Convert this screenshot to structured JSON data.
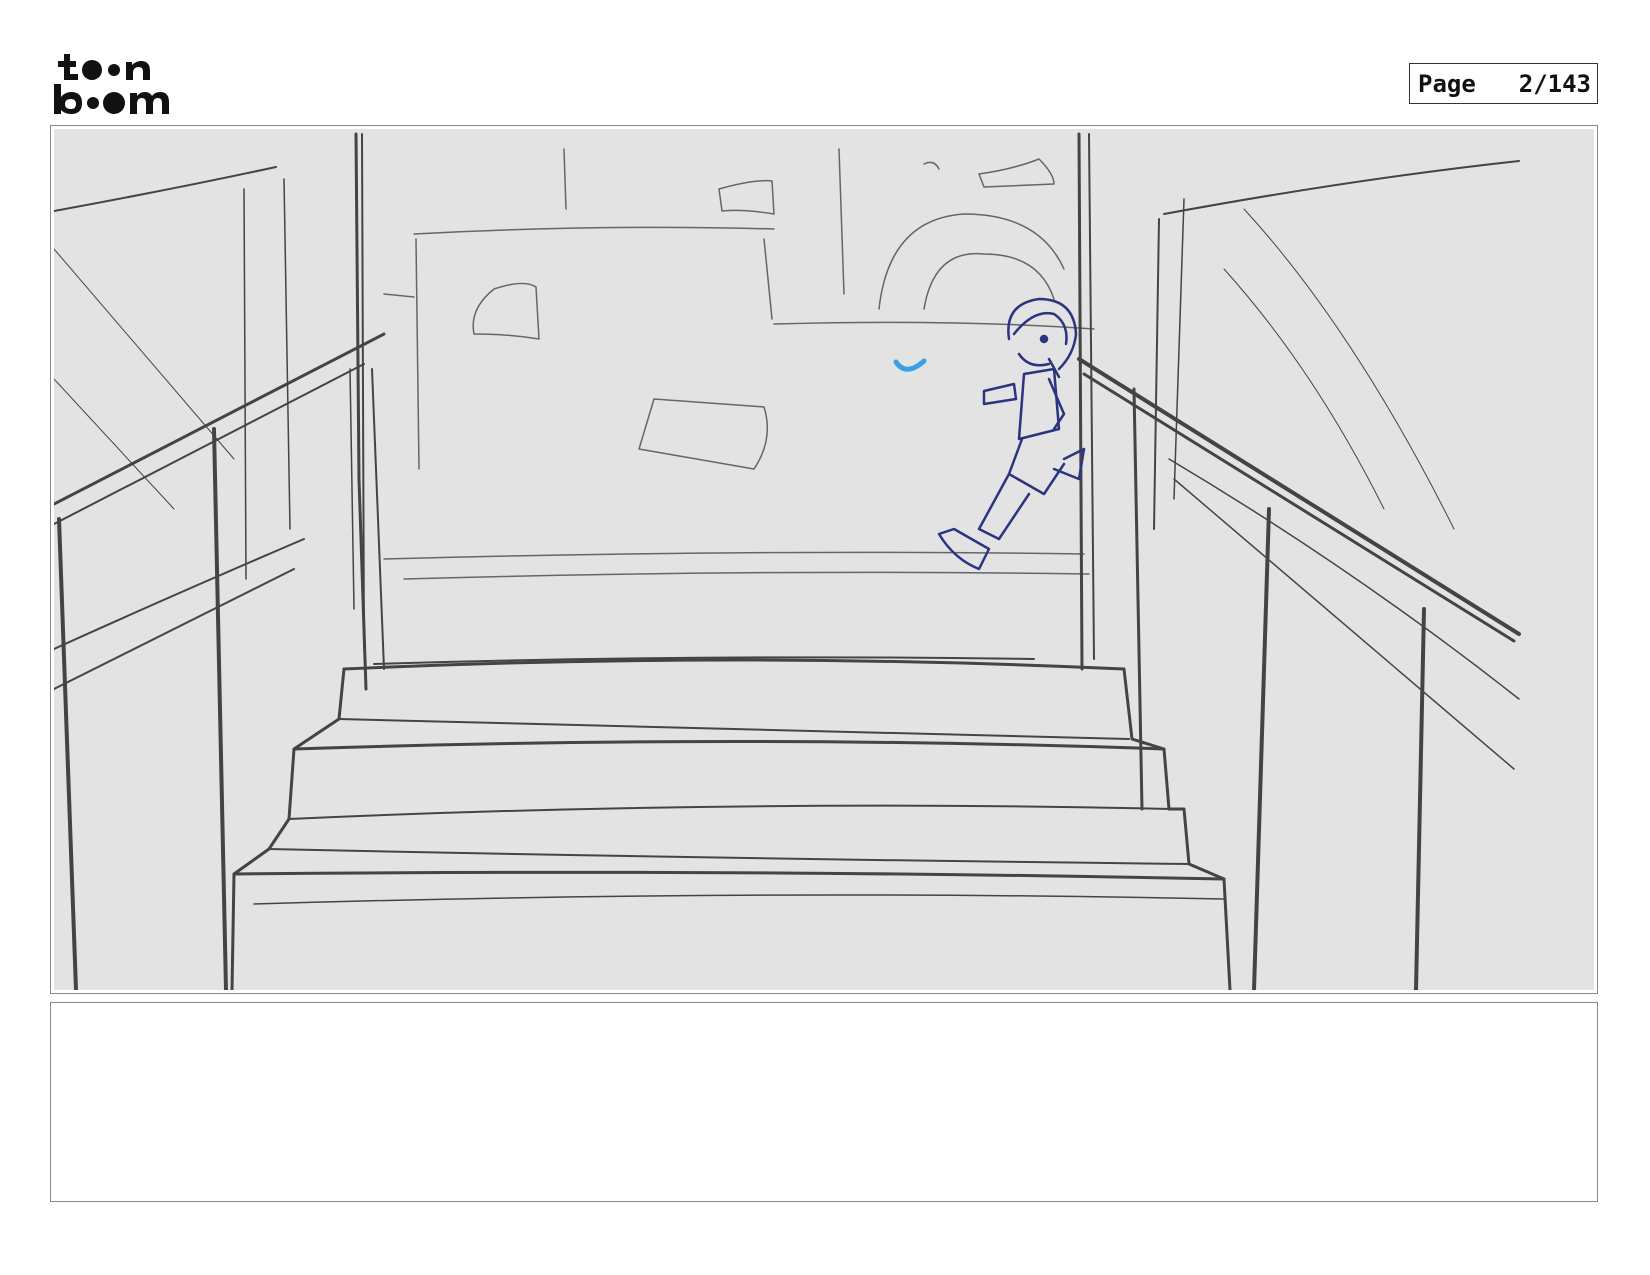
{
  "header": {
    "logo_text_top": "toon",
    "logo_text_bottom": "boom",
    "page_label": "Page",
    "page_number": "2/143"
  },
  "panel": {
    "background": "#e3e3e3",
    "sketch_color": "#444444",
    "character_color": "#2b3480",
    "accent_color": "#3aa0e6"
  },
  "notes": {
    "text": ""
  }
}
